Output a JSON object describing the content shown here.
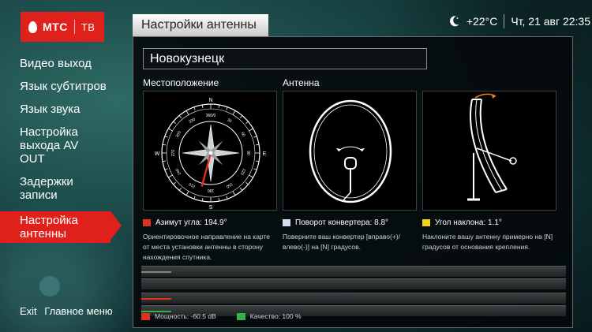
{
  "brand": {
    "name": "МТС",
    "product": "ТВ",
    "color": "#e0201b"
  },
  "status": {
    "weather_icon": "moon-icon",
    "temperature": "+22°C",
    "datetime": "Чт, 21 авг 22:35"
  },
  "menu": {
    "items": [
      {
        "label": "Видео выход"
      },
      {
        "label": "Язык субтитров"
      },
      {
        "label": "Язык звука"
      },
      {
        "label": "Настройка выхода AV OUT"
      },
      {
        "label": "Задержки записи"
      },
      {
        "label": "Настройка антенны",
        "active": true
      }
    ]
  },
  "footer": {
    "exit_key": "Exit",
    "exit_label": "Главное меню"
  },
  "panel": {
    "title": "Настройки антенны",
    "city": "Новокузнецк",
    "location_title": "Местоположение",
    "antenna_title": "Антенна",
    "compass": {
      "directions": [
        "N",
        "E",
        "S",
        "W"
      ],
      "ticks": [
        "360/0",
        "30",
        "60",
        "90",
        "120",
        "150",
        "180",
        "210",
        "240",
        "270",
        "300",
        "330"
      ]
    },
    "azimuth": {
      "label": "Азимут угла: 194.9°",
      "value": 194.9,
      "color": "#e03020",
      "desc": "Ориентировочное направление на карте от места установки антенны в сторону нахождения спутника."
    },
    "rotation": {
      "label": "Поворот конвертера: 8.8°",
      "value": 8.8,
      "color": "#d8dcf0",
      "desc": "Поверните ваш конвертер [вправо(+)/влево(-)] на [N] градусов."
    },
    "tilt": {
      "label": "Угол наклона: 1.1°",
      "value": 1.1,
      "color": "#f2d21a",
      "desc": "Наклоните вашу антенну примерно на [N] градусов от основания крепления."
    },
    "strength": {
      "label": "Мощность: -60.5 dB",
      "color": "#e03020",
      "level": 0.07
    },
    "quality": {
      "label": "Качество: 100 %",
      "color": "#33b24a",
      "level": 0.07
    }
  }
}
